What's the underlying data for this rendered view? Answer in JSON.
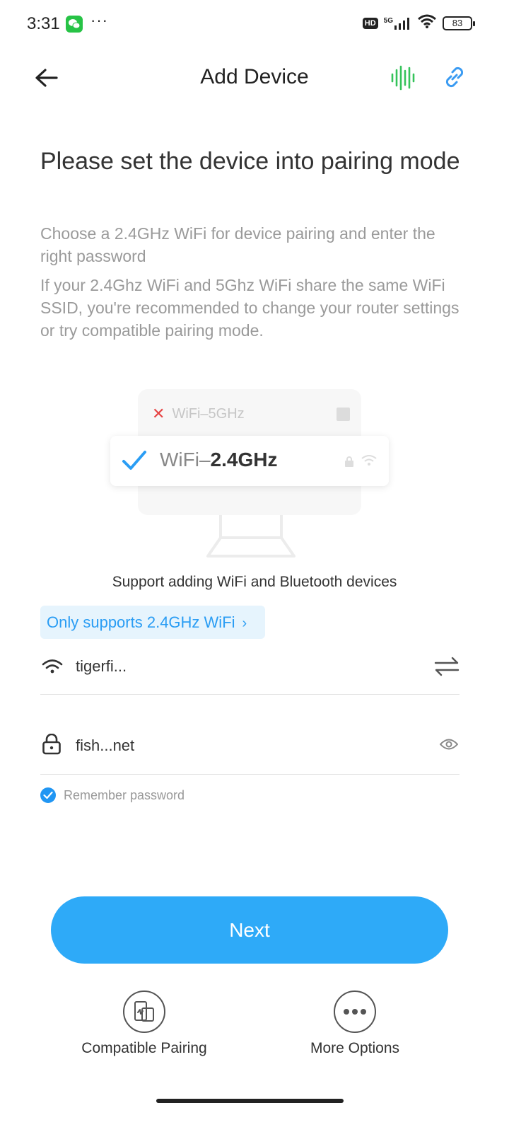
{
  "status_bar": {
    "time": "3:31",
    "dots": "···",
    "hd": "HD",
    "network": "5G",
    "battery": "83",
    "icons": [
      "wechat-icon",
      "signal-icon",
      "wifi-icon",
      "battery-icon"
    ]
  },
  "header": {
    "title": "Add Device",
    "icons": [
      "back-arrow-icon",
      "voice-wave-icon",
      "link-icon"
    ],
    "accent_green": "#35c35a",
    "accent_blue": "#3a9bf2"
  },
  "main": {
    "title": "Please set the device into pairing mode",
    "description_1": "Choose a 2.4GHz WiFi for device pairing and enter the right password",
    "description_2": "If your 2.4Ghz WiFi and 5Ghz WiFi share the same WiFi SSID, you're recommended to change your router settings or try compatible pairing mode."
  },
  "illustration": {
    "wifi_5g_label": "WiFi–5GHz",
    "wifi_24_prefix": "WiFi–",
    "wifi_24_bold": "2.4GHz"
  },
  "support_text": "Support adding WiFi and Bluetooth devices",
  "only_badge": {
    "label": "Only supports 2.4GHz WiFi",
    "chevron": "›"
  },
  "wifi_field": {
    "value": "tigerfi...",
    "icons": [
      "wifi-icon",
      "swap-icon"
    ]
  },
  "password_field": {
    "value": "fish...net",
    "icons": [
      "lock-icon",
      "eye-icon"
    ]
  },
  "remember": {
    "label": "Remember password",
    "checked": true
  },
  "next_button": {
    "label": "Next",
    "color": "#2eaaf8"
  },
  "bottom_options": [
    {
      "label": "Compatible Pairing",
      "icon": "compatible-pairing-icon"
    },
    {
      "label": "More Options",
      "icon": "more-options-icon"
    }
  ]
}
